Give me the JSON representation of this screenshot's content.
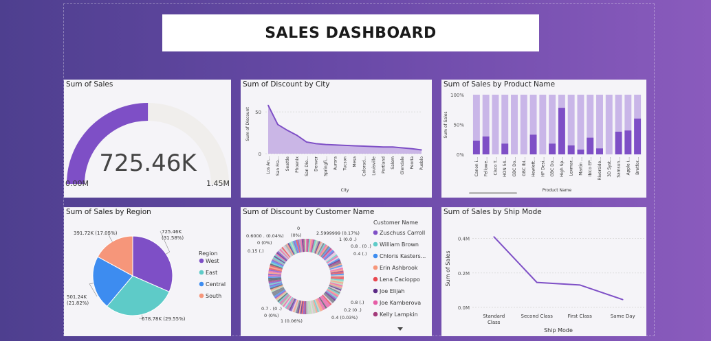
{
  "header": {
    "title": "SALES DASHBOARD"
  },
  "cards": {
    "gauge": {
      "title": "Sum of Sales"
    },
    "city": {
      "title": "Sum of Discount by City"
    },
    "product": {
      "title": "Sum of Sales by Product Name"
    },
    "region": {
      "title": "Sum of Sales by Region"
    },
    "customer": {
      "title": "Sum of Discount by Customer Name"
    },
    "shipmode": {
      "title": "Sum of Sales by Ship Mode"
    }
  },
  "colors": {
    "accent": "#7e4fc6",
    "light": "#c9b6e8",
    "gauge_bg": "#f0eeec",
    "area": "#c2aae3"
  },
  "chart_data": [
    {
      "type": "gauge",
      "title": "Sum of Sales",
      "value": 725.46,
      "value_label": "725.46K",
      "min": 0,
      "max": 1450,
      "min_label": "0.00M",
      "max_label": "1.45M"
    },
    {
      "type": "area",
      "title": "Sum of Discount by City",
      "xlabel": "City",
      "ylabel": "Sum of Discount",
      "categories": [
        "Los An...",
        "San Fra...",
        "Seattle",
        "Phoenix",
        "San Die...",
        "Denver",
        "Springfi...",
        "Aurora",
        "Tucson",
        "Mesa",
        "Colorad...",
        "Louisville",
        "Portland",
        "Salem",
        "Glendale",
        "Peoria",
        "Pueblo"
      ],
      "values": [
        58,
        35,
        28,
        22,
        14,
        12,
        11,
        10.5,
        10,
        9.5,
        9,
        8.5,
        8,
        8,
        7,
        6,
        4.5
      ],
      "yticks": [
        "0",
        "50"
      ],
      "ylim": [
        0,
        60
      ]
    },
    {
      "type": "bar",
      "stacked_percent": true,
      "title": "Sum of Sales by Product Name",
      "xlabel": "Product Name",
      "ylabel": "Sum of Sales",
      "categories": [
        "Canon i...",
        "Fellowe...",
        "Cisco T...",
        "HON 54...",
        "GBC Do...",
        "GBC Ibi...",
        "Hewlett...",
        "HP Desi...",
        "GBC Do...",
        "High Sp...",
        "Lexmar...",
        "Martin ...",
        "Ibico EP...",
        "Riverside...",
        "3D Syst...",
        "Samsun...",
        "Apple i...",
        "Bretfor..."
      ],
      "values": [
        23,
        30,
        0,
        18,
        0,
        0,
        33,
        0,
        18,
        78,
        15,
        8,
        28,
        10,
        0,
        38,
        40,
        60
      ],
      "yticks": [
        "0%",
        "50%",
        "100%"
      ]
    },
    {
      "type": "pie",
      "title": "Sum of Sales by Region",
      "legend_title": "Region",
      "slices": [
        {
          "name": "West",
          "value": 725.46,
          "label": "725.46K",
          "pct": "(31.58%)",
          "color": "#7e4fc6"
        },
        {
          "name": "East",
          "value": 678.78,
          "label": "678.78K (29.55%)",
          "pct": "",
          "color": "#5ecbc8"
        },
        {
          "name": "Central",
          "value": 501.24,
          "label": "501.24K",
          "pct": "(21.82%)",
          "color": "#3d8cf0"
        },
        {
          "name": "South",
          "value": 391.72,
          "label": "391.72K (17.05%)",
          "pct": "",
          "color": "#f6967a"
        }
      ]
    },
    {
      "type": "pie",
      "donut": true,
      "title": "Sum of Discount by Customer Name",
      "legend_title": "Customer Name",
      "legend": [
        {
          "name": "Zuschuss Carroll",
          "color": "#7e4fc6"
        },
        {
          "name": "William Brown",
          "color": "#5ecbc8"
        },
        {
          "name": "Chloris Kasters...",
          "color": "#3d8cf0"
        },
        {
          "name": "Erin Ashbrook",
          "color": "#f6967a"
        },
        {
          "name": "Lena Cacioppo",
          "color": "#e8474f"
        },
        {
          "name": "Joe Elijah",
          "color": "#5b2a86"
        },
        {
          "name": "Joe Kamberova",
          "color": "#e65ca6"
        },
        {
          "name": "Kelly Lampkin",
          "color": "#a33a7a"
        }
      ],
      "annotations": [
        "0",
        "(0%)",
        "2.5999999 (0.17%)",
        "0.6000 . (0.04%)",
        "1 (0.0 .)",
        "0 (0%)",
        "0.8 . (0 .)",
        "0.15 (.)",
        "0.4 (.)",
        "0.7 . (0 .)",
        "0.8 (.)",
        "0 (0%)",
        "0.2 (0 .)",
        "1 (0.06%)",
        "0.4 (0.03%)"
      ]
    },
    {
      "type": "line",
      "title": "Sum of Sales by Ship Mode",
      "xlabel": "Ship Mode",
      "ylabel": "Sum of Sales",
      "categories": [
        "Standard Class",
        "Second Class",
        "First Class",
        "Same Day"
      ],
      "values": [
        0.41,
        0.145,
        0.13,
        0.045
      ],
      "yticks": [
        "0.0M",
        "0.2M",
        "0.4M"
      ],
      "ylim": [
        0,
        0.45
      ]
    }
  ]
}
